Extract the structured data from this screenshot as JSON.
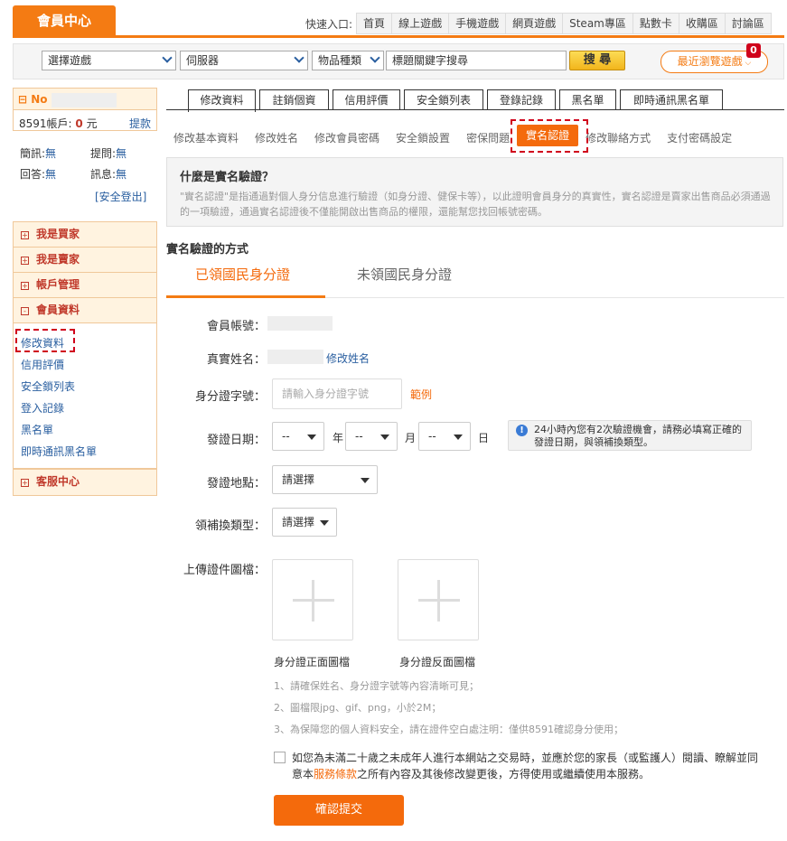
{
  "header": {
    "title": "會員中心",
    "quick_label": "快速入口:",
    "quick_links": [
      "首頁",
      "線上遊戲",
      "手機遊戲",
      "網頁遊戲",
      "Steam專區",
      "點數卡",
      "收購區",
      "討論區"
    ]
  },
  "search": {
    "game_select": "選擇遊戲",
    "server_select": "伺服器",
    "item_select": "物品種類",
    "keyword_placeholder": "標題關鍵字搜尋",
    "search_button": "搜 尋",
    "recent_button": "最近瀏覽遊戲",
    "recent_count": "0"
  },
  "sidebar": {
    "user_no": "No",
    "account_label": "8591帳戶:",
    "account_value": "0",
    "account_unit": "元",
    "withdraw": "提款",
    "stats": {
      "jianxun_label": "簡訊:",
      "jianxun_value": "無",
      "tiwen_label": "提問:",
      "tiwen_value": "無",
      "huida_label": "回答:",
      "huida_value": "無",
      "xixi_label": "訊息:",
      "xixi_value": "無"
    },
    "logout": "[安全登出]",
    "menu": [
      {
        "label": "我是買家",
        "sign": "+"
      },
      {
        "label": "我是賣家",
        "sign": "+"
      },
      {
        "label": "帳戶管理",
        "sign": "+"
      },
      {
        "label": "會員資料",
        "sign": "-"
      }
    ],
    "sub_links": [
      "修改資料",
      "信用評價",
      "安全鎖列表",
      "登入記錄",
      "黑名單",
      "即時通訊黑名單"
    ],
    "service": {
      "label": "客服中心",
      "sign": "+"
    }
  },
  "tabs": [
    "修改資料",
    "註銷個資",
    "信用評價",
    "安全鎖列表",
    "登錄記錄",
    "黑名單",
    "即時通訊黑名單"
  ],
  "subnav": [
    "修改基本資料",
    "修改姓名",
    "修改會員密碼",
    "安全鎖設置",
    "密保問題",
    "實名認證",
    "修改聯絡方式",
    "支付密碼設定"
  ],
  "info": {
    "title": "什麼是實名驗證？",
    "desc": "\"實名認證\"是指通過對個人身分信息進行驗證（如身分證、健保卡等），以此證明會員身分的真實性，實名認證是賣家出售商品必須通過的一項驗證，通過實名認證後不僅能開啟出售商品的權限，還能幫您找回帳號密碼。"
  },
  "method": {
    "title": "實名驗證的方式",
    "tab_active": "已領國民身分證",
    "tab_inactive": "未領國民身分證"
  },
  "form": {
    "account_label": "會員帳號：",
    "realname_label": "真實姓名：",
    "edit_name": "修改姓名",
    "id_label": "身分證字號：",
    "id_placeholder": "請輸入身分證字號",
    "example": "範例",
    "date_label": "發證日期：",
    "year_value": "--",
    "year_unit": "年",
    "month_value": "--",
    "month_unit": "月",
    "day_value": "--",
    "day_unit": "日",
    "tip": "24小時內您有2次驗證機會，請務必填寫正確的發證日期，與領補換類型。",
    "place_label": "發證地點：",
    "place_value": "請選擇",
    "type_label": "領補換類型：",
    "type_value": "請選擇",
    "upload_label": "上傳證件圖檔：",
    "upload_front": "身分證正面圖檔",
    "upload_back": "身分證反面圖檔",
    "notes": [
      "1、請確保姓名、身分證字號等內容清晰可見；",
      "2、圖檔限jpg、gif、png，小於2M；",
      "3、為保障您的個人資料安全，請在證件空白處注明：僅供8591確認身分使用；"
    ],
    "agree_text_1": "如您為未滿二十歲之未成年人進行本網站之交易時，並應於您的家長（或監護人）閱讀、瞭解並同意本",
    "agree_link": "服務條款",
    "agree_text_2": "之所有內容及其後修改變更後，方得使用或繼續使用本服務。",
    "submit": "確認提交"
  }
}
